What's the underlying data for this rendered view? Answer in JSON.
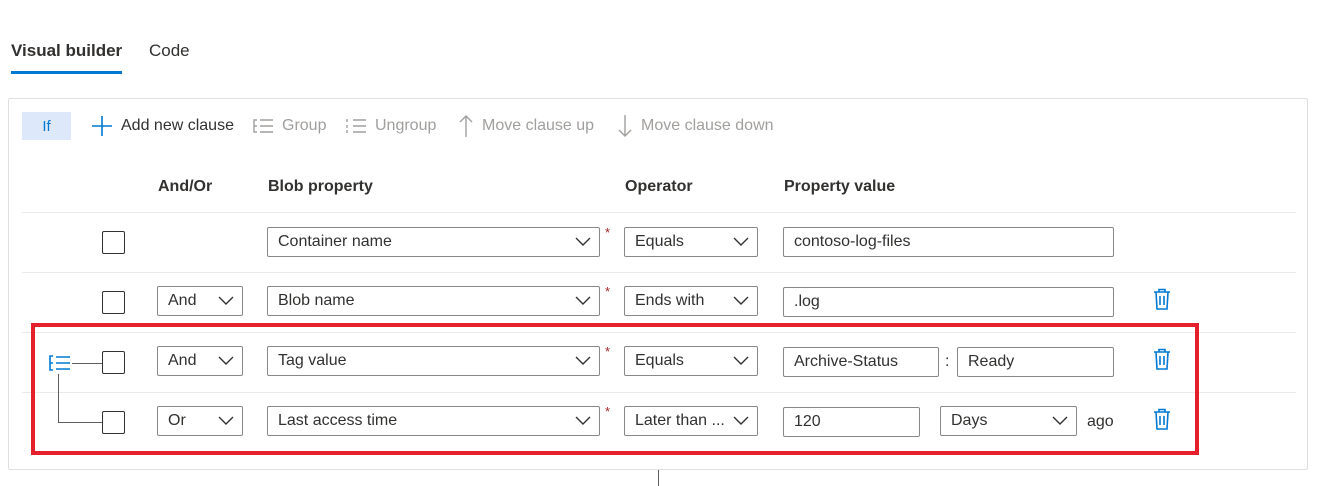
{
  "tabs": [
    {
      "label": "Visual builder",
      "active": true
    },
    {
      "label": "Code",
      "active": false
    }
  ],
  "toolbar": {
    "if_label": "If",
    "add_clause": "Add new clause",
    "group": "Group",
    "ungroup": "Ungroup",
    "move_up": "Move clause up",
    "move_down": "Move clause down"
  },
  "headers": {
    "and_or": "And/Or",
    "blob_property": "Blob property",
    "operator": "Operator",
    "property_value": "Property value"
  },
  "rows": [
    {
      "and_or": "",
      "property": "Container name",
      "operator": "Equals",
      "value": "contoso-log-files",
      "deletable": false
    },
    {
      "and_or": "And",
      "property": "Blob name",
      "operator": "Ends with",
      "value": ".log",
      "deletable": true
    },
    {
      "and_or": "And",
      "property": "Tag value",
      "operator": "Equals",
      "value": "Archive-Status",
      "value2": "Ready",
      "separator": ":",
      "deletable": true
    },
    {
      "and_or": "Or",
      "property": "Last access time",
      "operator": "Later than ...",
      "value": "120",
      "unit": "Days",
      "suffix": "ago",
      "deletable": true
    }
  ],
  "required_marker": "*",
  "colors": {
    "accent": "#0078d4",
    "highlight": "#e3202c",
    "if_bg": "#dde9fb"
  }
}
